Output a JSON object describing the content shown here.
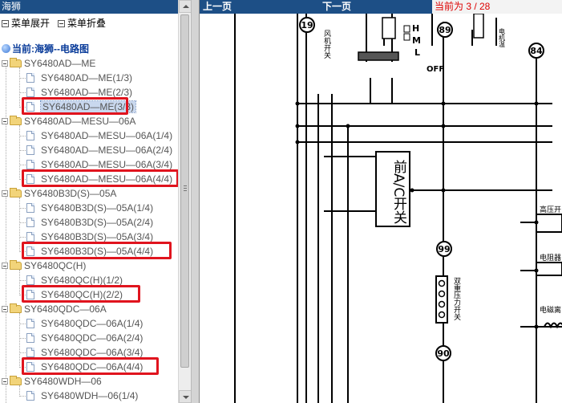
{
  "left_panel": {
    "title": "海狮",
    "expand_label": "菜单展开",
    "collapse_label": "菜单折叠",
    "root_label": "当前:海狮--电路图",
    "groups": [
      {
        "label": "SY6480AD—ME",
        "items": [
          "SY6480AD—ME(1/3)",
          "SY6480AD—ME(2/3)",
          "SY6480AD—ME(3/3)"
        ]
      },
      {
        "label": "SY6480AD—MESU—06A",
        "items": [
          "SY6480AD—MESU—06A(1/4)",
          "SY6480AD—MESU—06A(2/4)",
          "SY6480AD—MESU—06A(3/4)",
          "SY6480AD—MESU—06A(4/4)"
        ]
      },
      {
        "label": "SY6480B3D(S)—05A",
        "items": [
          "SY6480B3D(S)—05A(1/4)",
          "SY6480B3D(S)—05A(2/4)",
          "SY6480B3D(S)—05A(3/4)",
          "SY6480B3D(S)—05A(4/4)"
        ]
      },
      {
        "label": "SY6480QC(H)",
        "items": [
          "SY6480QC(H)(1/2)",
          "SY6480QC(H)(2/2)"
        ]
      },
      {
        "label": "SY6480QDC—06A",
        "items": [
          "SY6480QDC—06A(1/4)",
          "SY6480QDC—06A(2/4)",
          "SY6480QDC—06A(3/4)",
          "SY6480QDC—06A(4/4)"
        ]
      },
      {
        "label": "SY6480WDH—06",
        "items": [
          "SY6480WDH—06(1/4)"
        ]
      }
    ]
  },
  "viewer": {
    "prev_label": "上一页",
    "next_label": "下一页",
    "page_info": "当前为 3 / 28",
    "diagram_labels": {
      "ac_switch": "前A/C开关",
      "fan_switch": "风机开关",
      "fan_speeds": [
        "H",
        "M",
        "L",
        "OFF"
      ],
      "pressure_switch": "双重压力开关",
      "high_pressure": "高压开",
      "electromagnet": "电磁离",
      "motor": "电机温",
      "resistor_pack": "电阻器",
      "wire_numbers": [
        "19",
        "89",
        "84",
        "99",
        "90"
      ]
    }
  },
  "highlight_color": "#e0141e",
  "accent_color": "#1d4f86"
}
